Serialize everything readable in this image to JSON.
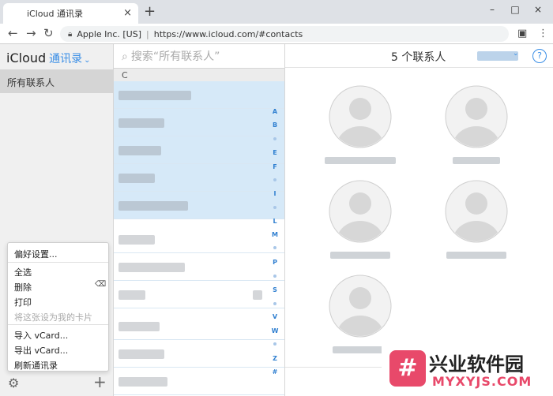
{
  "browser": {
    "tab_title": "iCloud 通讯录",
    "tab_close": "×",
    "new_tab": "+",
    "favicon": "",
    "site_identity": "Apple Inc. [US]",
    "url": "https://www.icloud.com/#contacts",
    "window_controls": [
      "–",
      "□",
      "×"
    ]
  },
  "sidebar": {
    "brand": "iCloud",
    "app_name": "通讯录",
    "app_chevron": "⌄",
    "group": "所有联系人",
    "menu": {
      "items": [
        "偏好设置...",
        "全选",
        "删除",
        "打印",
        "将这张设为我的卡片",
        "导入 vCard...",
        "导出 vCard...",
        "刷新通讯录"
      ],
      "disabled_item": "将这张设为我的卡片"
    },
    "add": "+"
  },
  "list": {
    "search_placeholder": "搜索“所有联系人”",
    "section": "C",
    "index": [
      "A",
      "B",
      "E",
      "F",
      "I",
      "L",
      "M",
      "P",
      "S",
      "V",
      "W",
      "Z",
      "#"
    ],
    "rows": 11,
    "selected_rows": 5
  },
  "detail": {
    "title": "5 个联系人",
    "help": "?",
    "contact_count": 5
  },
  "watermark": {
    "cn": "兴业软件园",
    "en": "MYXYJS.COM",
    "logo": "#"
  },
  "colors": {
    "accent": "#3a8ee6",
    "selection": "#d6e9f8",
    "watermark": "#e8496a"
  }
}
